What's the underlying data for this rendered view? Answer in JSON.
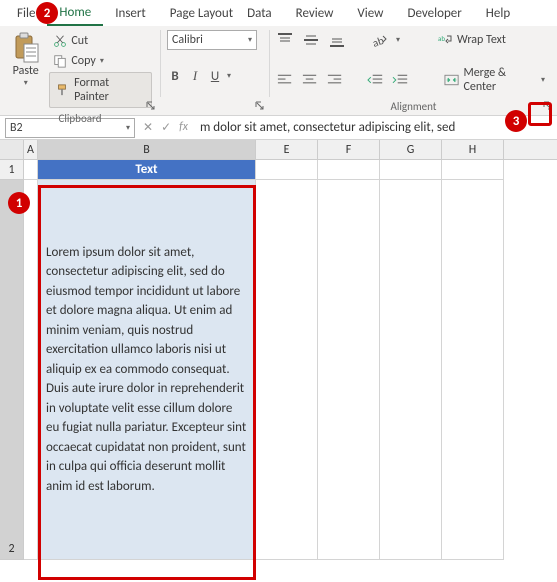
{
  "menu": {
    "file": "File",
    "home": "Home",
    "insert": "Insert",
    "page_layout": "Page Layout",
    "data": "Data",
    "review": "Review",
    "view": "View",
    "developer": "Developer",
    "help": "Help"
  },
  "clipboard": {
    "paste": "Paste",
    "cut": "Cut",
    "copy": "Copy",
    "format_painter": "Format Painter",
    "group_label": "Clipboard"
  },
  "font": {
    "name": "Calibri",
    "bold": "B",
    "italic": "I",
    "underline": "U"
  },
  "alignment": {
    "wrap_text": "Wrap Text",
    "merge_center": "Merge & Center",
    "group_label": "Alignment"
  },
  "namebox": "B2",
  "formula": "m dolor sit amet, consectetur adipiscing elit, sed",
  "columns": {
    "A": "A",
    "B": "B",
    "E": "E",
    "F": "F",
    "G": "G",
    "H": "H"
  },
  "rows": {
    "r1": "1",
    "r2": "2"
  },
  "b1": "Text",
  "b2": "Lorem ipsum dolor sit amet, consectetur adipiscing elit, sed do eiusmod tempor incididunt ut labore et dolore magna aliqua. Ut enim ad minim veniam, quis nostrud exercitation ullamco laboris nisi ut aliquip ex ea commodo consequat. Duis aute irure dolor in reprehenderit in voluptate velit esse cillum dolore eu fugiat nulla pariatur. Excepteur sint occaecat cupidatat non proident, sunt in culpa qui officia deserunt mollit anim id est laborum.",
  "annotations": {
    "a1": "1",
    "a2": "2",
    "a3": "3"
  }
}
